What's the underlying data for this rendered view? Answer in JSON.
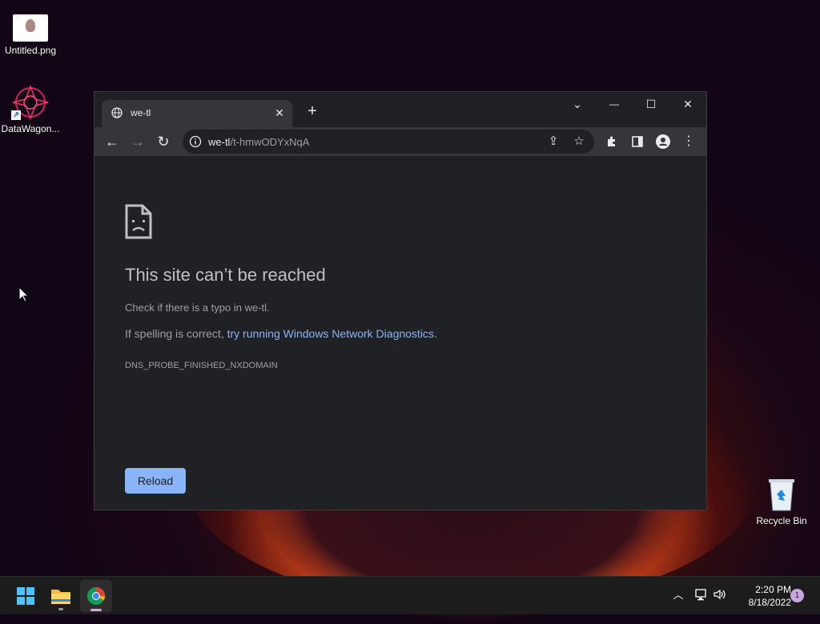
{
  "desktop": {
    "icons": [
      {
        "label": "Untitled.png"
      },
      {
        "label": "DataWagon..."
      },
      {
        "label": "Recycle Bin"
      }
    ]
  },
  "browser": {
    "tab": {
      "title": "we-tl",
      "close_glyph": "✕"
    },
    "new_tab_glyph": "+",
    "window_controls": {
      "tab_search": "⌄",
      "minimize": "—",
      "maximize": "☐",
      "close": "✕"
    },
    "address": {
      "host": "we-tl",
      "path": "/t-hmwODYxNqA"
    },
    "toolbar_icons": [
      "back-icon",
      "forward-icon",
      "reload-icon",
      "share-icon",
      "star-icon",
      "extensions-icon",
      "side-panel-icon",
      "profile-icon",
      "menu-icon"
    ],
    "error": {
      "title": "This site can’t be reached",
      "line1": "Check if there is a typo in we-tl.",
      "line2_prefix": "If spelling is correct, ",
      "line2_link": "try running Windows Network Diagnostics",
      "line2_suffix": ".",
      "code": "DNS_PROBE_FINISHED_NXDOMAIN",
      "reload_label": "Reload"
    }
  },
  "taskbar": {
    "apps": [
      "start-icon",
      "file-explorer-icon",
      "chrome-icon"
    ],
    "tray_icons": [
      "chevron-up-icon",
      "network-icon",
      "volume-icon"
    ],
    "time": "2:20 PM",
    "date": "8/18/2022",
    "notification_count": "1"
  },
  "colors": {
    "chrome_frame": "#202124",
    "chrome_toolbar": "#35363a",
    "link": "#8ab4f8",
    "taskbar": "#1c1c1c"
  }
}
